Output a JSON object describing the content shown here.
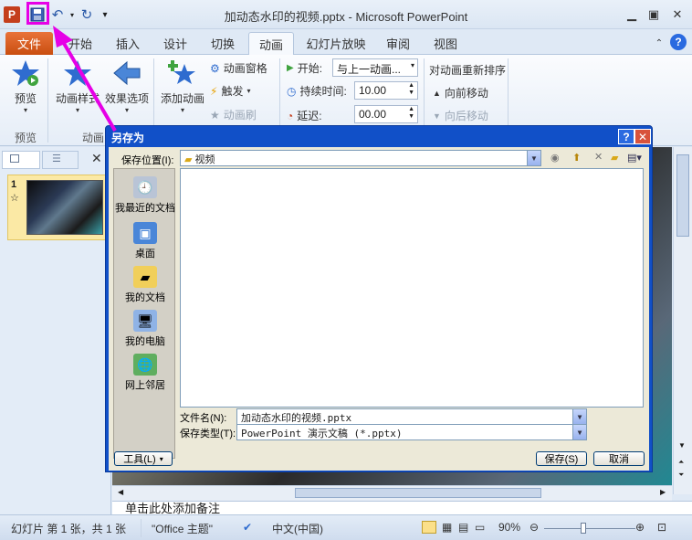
{
  "window": {
    "title": "加动态水印的视频.pptx - Microsoft PowerPoint"
  },
  "qat": {
    "save_icon": "save-icon",
    "undo_icon": "undo-icon",
    "redo_icon": "redo-icon"
  },
  "tabs": [
    "文件",
    "开始",
    "插入",
    "设计",
    "切换",
    "动画",
    "幻灯片放映",
    "审阅",
    "视图"
  ],
  "ribbon": {
    "preview": {
      "label": "预览",
      "group": "预览"
    },
    "animation_styles": "动画样式",
    "effect_options": "效果选项",
    "anim_group": "动画",
    "add_animation": "添加动画",
    "animation_pane": "动画窗格",
    "trigger": "触发",
    "animation_painter": "动画刷",
    "start_label": "开始:",
    "start_value": "与上一动画...",
    "duration_label": "持续时间:",
    "duration_value": "10.00",
    "delay_label": "延迟:",
    "delay_value": "00.00",
    "reorder_title": "对动画重新排序",
    "move_earlier": "向前移动",
    "move_later": "向后移动"
  },
  "slides_pane": {
    "slide_number": "1",
    "star": "☆"
  },
  "notes": {
    "text": "单击此处添加备注"
  },
  "status": {
    "slide_info": "幻灯片 第 1 张，共 1 张",
    "theme": "\"Office 主题\"",
    "language": "中文(中国)",
    "zoom": "90%"
  },
  "dialog": {
    "title": "另存为",
    "save_in_label": "保存位置(I):",
    "save_in_value": "视频",
    "places": [
      "我最近的文档",
      "桌面",
      "我的文档",
      "我的电脑",
      "网上邻居"
    ],
    "file_name_label": "文件名(N):",
    "file_name_value": "加动态水印的视频.pptx",
    "file_type_label": "保存类型(T):",
    "file_type_value": "PowerPoint 演示文稿 (*.pptx)",
    "tools_label": "工具(L)",
    "save_label": "保存(S)",
    "cancel_label": "取消"
  },
  "colors": {
    "annotation": "#e600e6",
    "dialog_title": "#1150c8",
    "file_tab": "#d35a1c"
  }
}
